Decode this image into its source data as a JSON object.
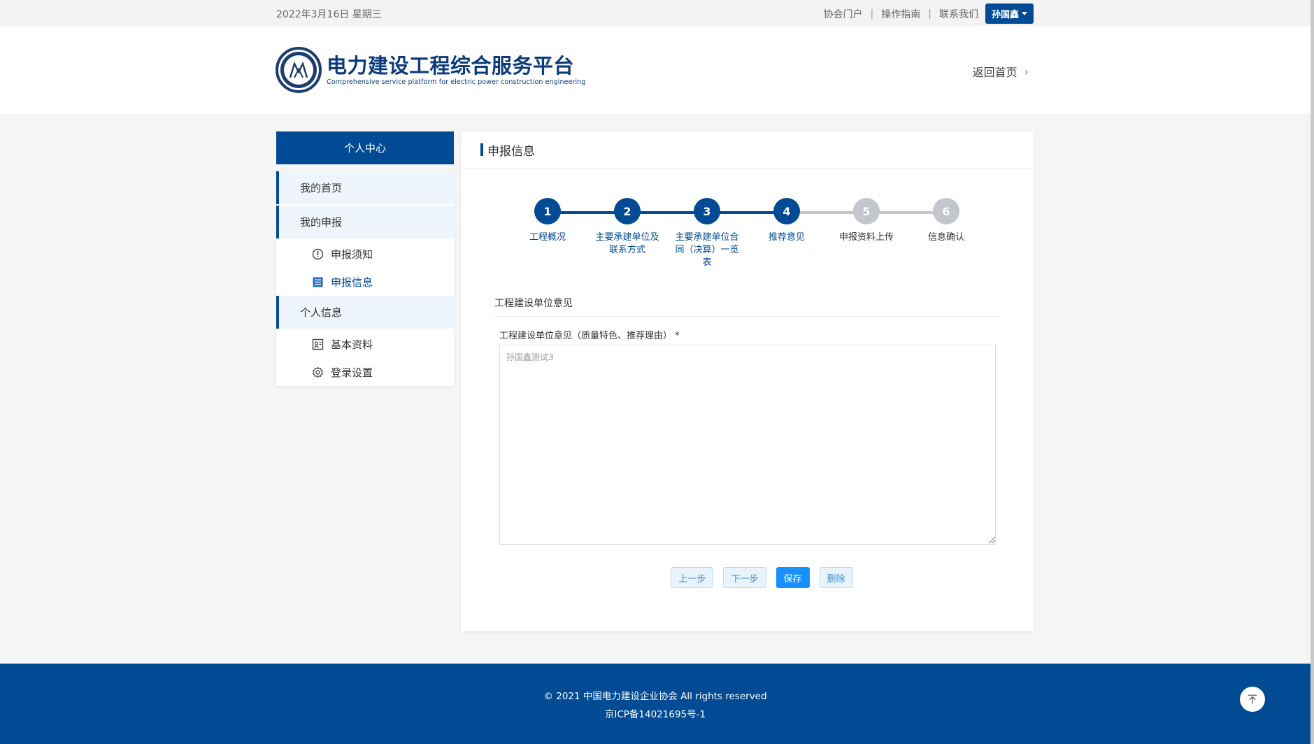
{
  "topbar": {
    "date": "2022年3月16日 星期三",
    "links": [
      "协会门户",
      "操作指南",
      "联系我们"
    ],
    "user": "孙国鑫"
  },
  "header": {
    "logo_title": "电力建设工程综合服务平台",
    "logo_subtitle": "Comprehensive service platform for electric power construction engineering",
    "back_home": "返回首页"
  },
  "sidebar": {
    "title": "个人中心",
    "groups": [
      {
        "label": "我的首页",
        "items": []
      },
      {
        "label": "我的申报",
        "items": [
          {
            "label": "申报须知",
            "icon": "info-circle-icon",
            "active": false
          },
          {
            "label": "申报信息",
            "icon": "list-icon",
            "active": true
          }
        ]
      },
      {
        "label": "个人信息",
        "items": [
          {
            "label": "基本资料",
            "icon": "id-card-icon",
            "active": false
          },
          {
            "label": "登录设置",
            "icon": "gear-icon",
            "active": false
          }
        ]
      }
    ]
  },
  "main": {
    "title": "申报信息",
    "steps": [
      {
        "num": "1",
        "label": "工程概况",
        "done": true
      },
      {
        "num": "2",
        "label": "主要承建单位及联系方式",
        "done": true
      },
      {
        "num": "3",
        "label": "主要承建单位合同（决算）一览表",
        "done": true
      },
      {
        "num": "4",
        "label": "推荐意见",
        "done": true
      },
      {
        "num": "5",
        "label": "申报资料上传",
        "done": false
      },
      {
        "num": "6",
        "label": "信息确认",
        "done": false
      }
    ],
    "section_title": "工程建设单位意见",
    "field_label": "工程建设单位意见（质量特色、推荐理由）",
    "required_mark": "*",
    "field_value": "孙国鑫测试3",
    "buttons": {
      "prev": "上一步",
      "next": "下一步",
      "save": "保存",
      "delete": "删除"
    }
  },
  "footer": {
    "copyright": "© 2021 中国电力建设企业协会 All rights reserved",
    "icp": "京ICP备14021695号-1"
  },
  "colors": {
    "primary": "#004b93",
    "accent": "#1890ff",
    "inactive": "#c3c6cc"
  }
}
